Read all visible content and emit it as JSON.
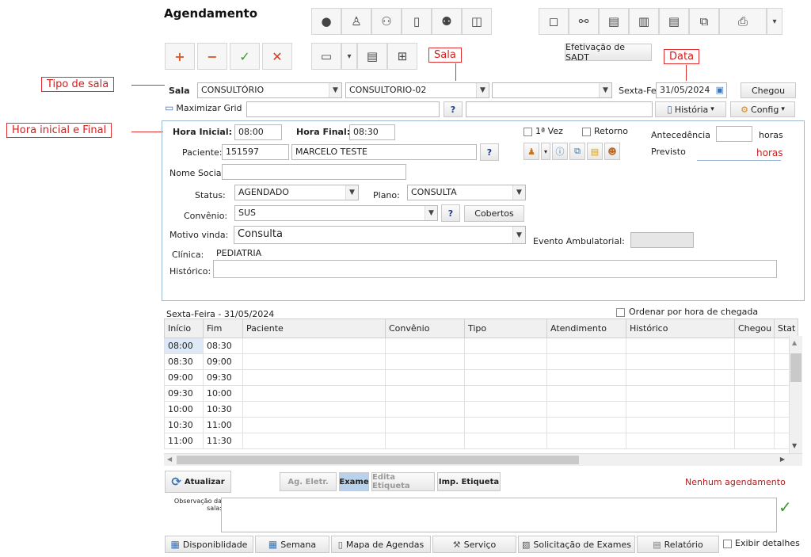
{
  "header": {
    "title": "Agendamento"
  },
  "toolbar": {
    "efetivacao_label": "Efetivação de SADT",
    "maximizar_label": "Maximizar Grid",
    "historia_label": "História",
    "config_label": "Config",
    "chegou_label": "Chegou",
    "question": "?"
  },
  "annotations": {
    "tipo_sala": "Tipo de sala",
    "hora": "Hora inicial e Final",
    "sala": "Sala",
    "data": "Data"
  },
  "filters": {
    "sala_label": "Sala",
    "tipo_sala": "CONSULTÓRIO",
    "sala": "CONSULTORIO-02",
    "sala_extra": "",
    "weekday": "Sexta-Fei",
    "date": "31/05/2024"
  },
  "form": {
    "hora_inicial_label": "Hora Inicial:",
    "hora_inicial": "08:00",
    "hora_final_label": "Hora Final:",
    "hora_final": "08:30",
    "primeira_vez_label": "1ª Vez",
    "retorno_label": "Retorno",
    "antecedencia_label": "Antecedência",
    "horas_label": "horas",
    "previsto_label": "Previsto",
    "previsto_value": "horas",
    "paciente_label": "Paciente:",
    "paciente_id": "151597",
    "paciente_nome": "MARCELO TESTE",
    "nome_social_label": "Nome Social:",
    "status_label": "Status:",
    "status": "AGENDADO",
    "plano_label": "Plano:",
    "plano": "CONSULTA",
    "convenio_label": "Convênio:",
    "convenio": "SUS",
    "cobertos_label": "Cobertos",
    "motivo_label": "Motivo vinda:",
    "motivo": "Consulta",
    "evento_label": "Evento Ambulatorial:",
    "clinica_label": "Clínica:",
    "clinica": "PEDIATRIA",
    "historico_label": "Histórico:"
  },
  "grid": {
    "date_label": "Sexta-Feira - 31/05/2024",
    "ordenar_label": "Ordenar por hora de chegada",
    "columns": [
      "Início",
      "Fim",
      "Paciente",
      "Convênio",
      "Tipo",
      "Atendimento",
      "Histórico",
      "Chegou",
      "Stat"
    ],
    "rows": [
      [
        "08:00",
        "08:30"
      ],
      [
        "08:30",
        "09:00"
      ],
      [
        "09:00",
        "09:30"
      ],
      [
        "09:30",
        "10:00"
      ],
      [
        "10:00",
        "10:30"
      ],
      [
        "10:30",
        "11:00"
      ],
      [
        "11:00",
        "11:30"
      ]
    ]
  },
  "actions": {
    "atualizar": "Atualizar",
    "ag_eletr": "Ag. Eletr.",
    "exame": "Exame",
    "edita_etiqueta": "Edita Etiqueta",
    "imp_etiqueta": "Imp. Etiqueta",
    "nenhum": "Nenhum agendamento",
    "observacao": "Observação da sala:"
  },
  "footer": {
    "disponibilidade": "Disponiblidade",
    "semana": "Semana",
    "mapa": "Mapa de Agendas",
    "servico": "Serviço",
    "solicitacao": "Solicitação de Exames",
    "relatorio": "Relatório",
    "exibir": "Exibir detalhes"
  },
  "colors": {
    "accent": "#3a74b4",
    "annotation": "#d21d1d",
    "panel_border": "#9bb8d3"
  }
}
